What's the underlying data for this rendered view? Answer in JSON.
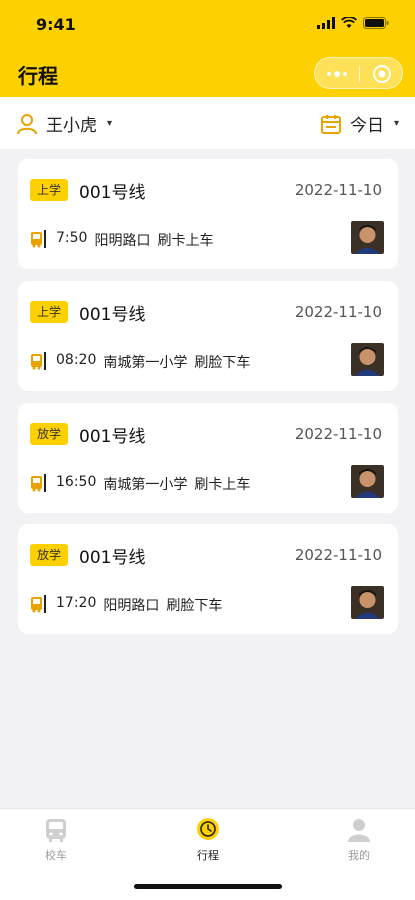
{
  "status_bar": {
    "time": "9:41"
  },
  "nav": {
    "title": "行程"
  },
  "filter": {
    "student_name": "王小虎",
    "date_label": "今日",
    "caret": "▾"
  },
  "trips": [
    {
      "badge": "上学",
      "line": "001号线",
      "date": "2022-11-10",
      "time": "7:50",
      "stop": "阳明路口",
      "action": "刷卡上车"
    },
    {
      "badge": "上学",
      "line": "001号线",
      "date": "2022-11-10",
      "time": "08:20",
      "stop": "南城第一小学",
      "action": "刷脸下车"
    },
    {
      "badge": "放学",
      "line": "001号线",
      "date": "2022-11-10",
      "time": "16:50",
      "stop": "南城第一小学",
      "action": "刷卡上车"
    },
    {
      "badge": "放学",
      "line": "001号线",
      "date": "2022-11-10",
      "time": "17:20",
      "stop": "阳明路口",
      "action": "刷脸下车"
    }
  ],
  "tabbar": {
    "items": [
      {
        "label": "校车",
        "icon": "bus-icon",
        "active": false
      },
      {
        "label": "行程",
        "icon": "clock-icon",
        "active": true
      },
      {
        "label": "我的",
        "icon": "user-icon",
        "active": false
      }
    ]
  },
  "colors": {
    "accent": "#fdd000",
    "background": "#f2f2f4",
    "icon_orange": "#e8a300"
  }
}
